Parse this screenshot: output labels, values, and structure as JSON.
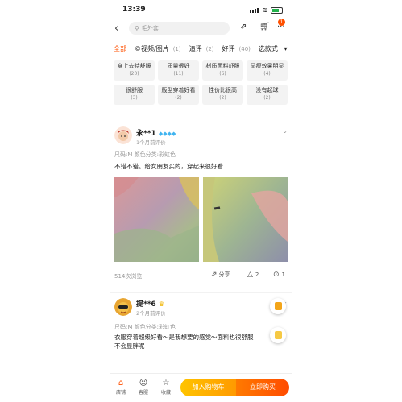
{
  "status_bar": {
    "time": "13:39"
  },
  "search": {
    "placeholder": "毛外套"
  },
  "header": {
    "cart_badge": "1"
  },
  "tabs": [
    {
      "label": "全部",
      "count": ""
    },
    {
      "label": "©视频/图片",
      "count": "(1)"
    },
    {
      "label": "追评",
      "count": "(2)"
    },
    {
      "label": "好评",
      "count": "(40)"
    },
    {
      "label": "选款式",
      "count": ""
    }
  ],
  "tags": [
    {
      "label": "穿上去特舒服",
      "count": "(20)"
    },
    {
      "label": "质量很好",
      "count": "(11)"
    },
    {
      "label": "材质面料舒服",
      "count": "(6)"
    },
    {
      "label": "显瘦效果明显",
      "count": "(4)"
    },
    {
      "label": "很舒服",
      "count": "(3)"
    },
    {
      "label": "版型穿着好看",
      "count": "(2)"
    },
    {
      "label": "性价比很高",
      "count": "(2)"
    },
    {
      "label": "没有起球",
      "count": "(2)"
    }
  ],
  "reviews": [
    {
      "user": "永**1",
      "time": "1个月前评价",
      "sku": "尺码:M 颜色分类:彩虹色",
      "text": "不错不错。给女朋友买的，穿起来很好看",
      "views": "514次浏览",
      "share_label": "分享",
      "like_count": "2",
      "comment_count": "1"
    },
    {
      "user": "提**6",
      "time": "2个月前评价",
      "sku": "尺码:M 颜色分类:彩虹色",
      "text_line1": "衣服穿着超级好看～是我想要的感觉～面料也很舒服",
      "text_line2": "不会显胖呢"
    }
  ],
  "bottom_bar": {
    "shop": "店铺",
    "service": "客服",
    "favorite": "收藏",
    "add_cart": "加入购物车",
    "buy_now": "立即购买"
  },
  "colors": {
    "accent": "#ff5000",
    "cart_button": "#ffb000",
    "buy_button": "#ff5500"
  }
}
